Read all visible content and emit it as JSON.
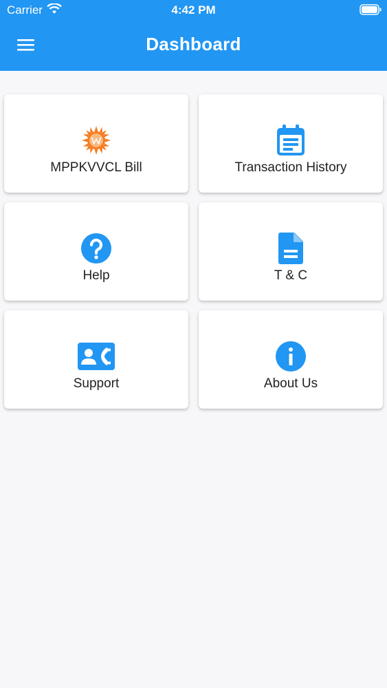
{
  "status_bar": {
    "carrier": "Carrier",
    "time": "4:42 PM"
  },
  "header": {
    "title": "Dashboard",
    "menu_icon": "hamburger-menu-icon",
    "background_color": "#2196f3"
  },
  "tiles": [
    {
      "label": "MPPKVVCL Bill",
      "icon": "mppkvvcl-logo-icon"
    },
    {
      "label": "Transaction History",
      "icon": "calendar-icon"
    },
    {
      "label": "Help",
      "icon": "help-circle-icon"
    },
    {
      "label": "T & C",
      "icon": "document-icon"
    },
    {
      "label": "Support",
      "icon": "contact-phone-icon"
    },
    {
      "label": "About Us",
      "icon": "info-circle-icon"
    }
  ],
  "accent_color": "#2196f3",
  "logo_color": "#f57c20"
}
